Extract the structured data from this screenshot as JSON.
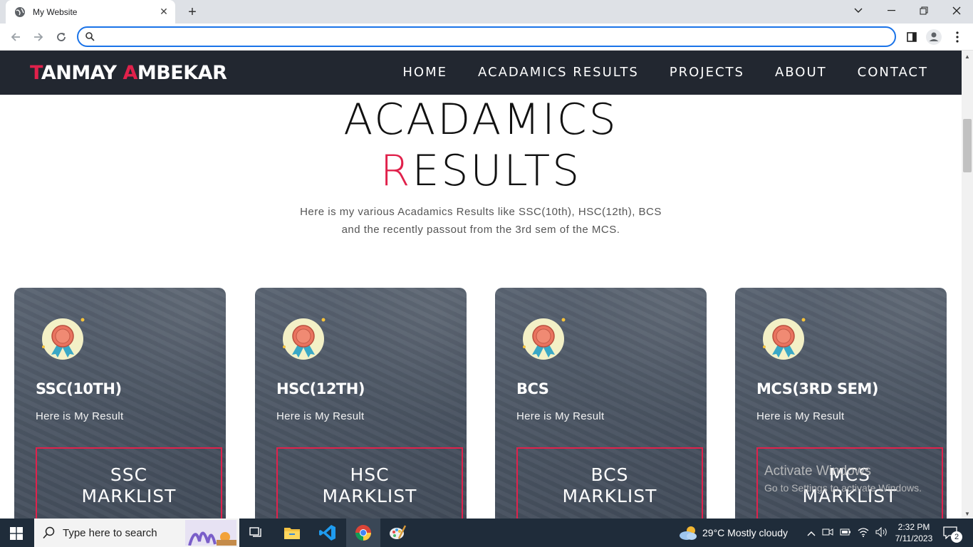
{
  "browser": {
    "tab_title": "My Website",
    "address_placeholder": ""
  },
  "site": {
    "logo_first_initial": "T",
    "logo_first_rest": "ANMAY ",
    "logo_last_initial": "A",
    "logo_last_rest": "MBEKAR",
    "nav": [
      "HOME",
      "ACADAMICS RESULTS",
      "PROJECTS",
      "ABOUT",
      "CONTACT"
    ],
    "accent_color": "#e0214b",
    "header_color": "#222730"
  },
  "section": {
    "title_line1": "ACADAMICS",
    "title_line2_initial": "R",
    "title_line2_rest": "ESULTS",
    "intro_line1": "Here is my various Acadamics Results like SSC(10th), HSC(12th), BCS",
    "intro_line2": "and the recently passout from the 3rd sem of the MCS."
  },
  "cards": [
    {
      "name": "SSC(10TH)",
      "subtitle": "Here is My Result",
      "button_line1": "SSC",
      "button_line2": "MARKLIST"
    },
    {
      "name": "HSC(12TH)",
      "subtitle": "Here is My Result",
      "button_line1": "HSC",
      "button_line2": "MARKLIST"
    },
    {
      "name": "BCS",
      "subtitle": "Here is My Result",
      "button_line1": "BCS",
      "button_line2": "MARKLIST"
    },
    {
      "name": "MCS(3RD SEM)",
      "subtitle": "Here is My Result",
      "button_line1": "MCS",
      "button_line2": "MARKLIST"
    }
  ],
  "watermark": {
    "line1": "Activate Windows",
    "line2": "Go to Settings to activate Windows."
  },
  "taskbar": {
    "search_text": "Type here to search",
    "weather": "29°C  Mostly cloudy",
    "time": "2:32 PM",
    "date": "7/11/2023",
    "notification_count": "2"
  }
}
